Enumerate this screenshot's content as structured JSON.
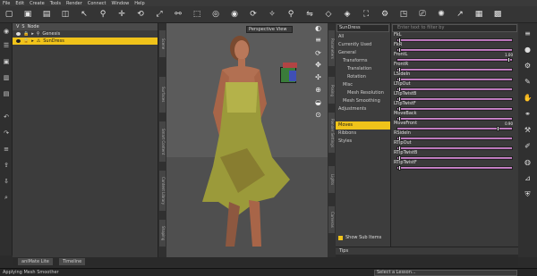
{
  "menu": [
    "File",
    "Edit",
    "Create",
    "Tools",
    "Render",
    "Connect",
    "Window",
    "Help"
  ],
  "toolbar_icons": [
    "new-icon",
    "open-icon",
    "save-icon",
    "node-icon",
    "cursor-icon",
    "pose-icon",
    "translate-icon",
    "rotate-icon",
    "scale-icon",
    "joint-icon",
    "region-icon",
    "spot-render-icon",
    "spot-render-2-icon",
    "rotate-view-icon",
    "bone-icon",
    "pin-icon",
    "mirror-icon",
    "geometry-icon",
    "surface-icon",
    "render-icon",
    "render-settings-icon",
    "camera-icon",
    "photo-icon",
    "light-icon",
    "pointer-icon",
    "render-window-icon",
    "layout-icon"
  ],
  "scene": {
    "header_label": "Node",
    "rows": [
      {
        "label": "Genesis",
        "selected": false
      },
      {
        "label": "SunDress",
        "selected": true
      }
    ]
  },
  "viewport": {
    "view_label": "Perspective View"
  },
  "params": {
    "node_select": "SunDress",
    "search_placeholder": "Enter text to filter by",
    "categories": [
      {
        "label": "All",
        "selected": false,
        "indent": 0
      },
      {
        "label": "Currently Used",
        "selected": false,
        "indent": 0
      },
      {
        "label": "General",
        "selected": false,
        "indent": 0
      },
      {
        "label": "Transforms",
        "selected": false,
        "indent": 1
      },
      {
        "label": "Translation",
        "selected": false,
        "indent": 2
      },
      {
        "label": "Rotation",
        "selected": false,
        "indent": 2
      },
      {
        "label": "Misc",
        "selected": false,
        "indent": 1
      },
      {
        "label": "Mesh Resolution",
        "selected": false,
        "indent": 2
      },
      {
        "label": "Mesh Smoothing",
        "selected": false,
        "indent": 1
      },
      {
        "label": "Adjustments",
        "selected": false,
        "indent": 0
      },
      {
        "label": "",
        "selected": false,
        "indent": 0
      },
      {
        "label": "Moves",
        "selected": true,
        "indent": 0
      },
      {
        "label": "Ribbons",
        "selected": false,
        "indent": 0
      },
      {
        "label": "Styles",
        "selected": false,
        "indent": 0
      }
    ],
    "show_sub_items": "Show Sub Items",
    "sliders": [
      {
        "label": "FkL",
        "value": "",
        "knob": 0.02
      },
      {
        "label": "FkR",
        "value": "",
        "knob": 0.02
      },
      {
        "label": "FrontL",
        "value": "1.00",
        "knob": 0.98
      },
      {
        "label": "FrontR",
        "value": "",
        "knob": 0.02
      },
      {
        "label": "LSideIn",
        "value": "",
        "knob": 0.02
      },
      {
        "label": "LTipOut",
        "value": "",
        "knob": 0.02
      },
      {
        "label": "LTipTwistB",
        "value": "",
        "knob": 0.02
      },
      {
        "label": "LTipTwistF",
        "value": "",
        "knob": 0.02
      },
      {
        "label": "MoveBack",
        "value": "",
        "knob": 0.02
      },
      {
        "label": "MoveFront",
        "value": "0.90",
        "knob": 0.88
      },
      {
        "label": "RSideIn",
        "value": "",
        "knob": 0.02
      },
      {
        "label": "RTipOut",
        "value": "",
        "knob": 0.02
      },
      {
        "label": "RTipTwistB",
        "value": "",
        "knob": 0.02
      },
      {
        "label": "RTipTwistF",
        "value": "",
        "knob": 0.02
      }
    ]
  },
  "tips_label": "Tips",
  "bottom_tabs": [
    "aniMate Lite",
    "Timeline"
  ],
  "status_text": "Applying Mesh Smoother",
  "lesson_select": "Select a Lesson...",
  "side_tabs_left": [
    "Scene",
    "Surfaces",
    "Smart Content",
    "Content Library",
    "Shaping"
  ],
  "side_tabs_right": [
    "Parameters",
    "Posing",
    "Render Settings",
    "Lights",
    "Cameras"
  ]
}
